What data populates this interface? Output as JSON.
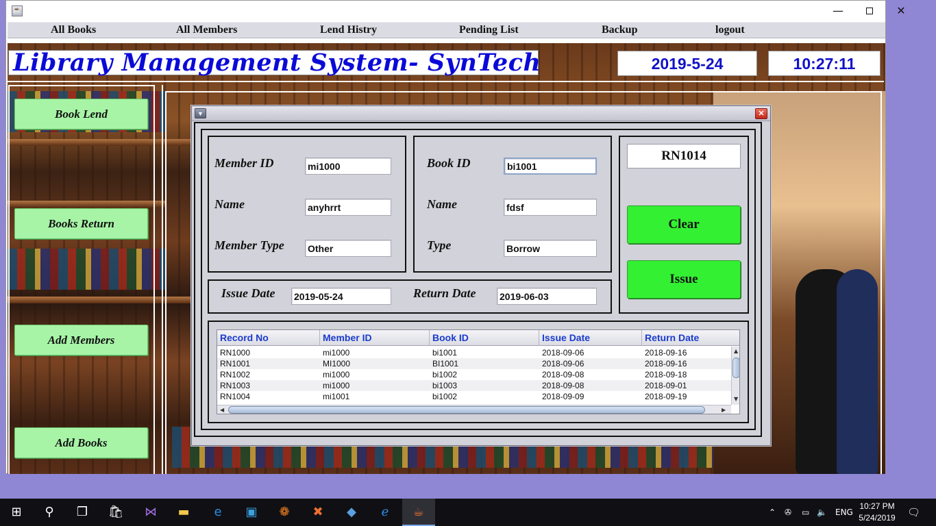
{
  "window": {
    "app_icon": "java-cup-icon",
    "minimize": "—",
    "close": "✕"
  },
  "menu": {
    "items": [
      "All Books",
      "All Members",
      "Lend Histry",
      "Pending List",
      "Backup",
      "logout"
    ]
  },
  "header": {
    "title": "Library Management System- SynTech",
    "date": "2019-5-24",
    "time": "10:27:11"
  },
  "sidebar": {
    "buttons": [
      "Book Lend",
      "Books Return",
      "Add Members",
      "Add Books"
    ]
  },
  "dialog": {
    "member": {
      "id_label": "Member ID",
      "id_value": "mi1000",
      "name_label": "Name",
      "name_value": "anyhrrt",
      "type_label": "Member Type",
      "type_value": "Other"
    },
    "book": {
      "id_label": "Book ID",
      "id_value": "bi1001",
      "name_label": "Name",
      "name_value": "fdsf",
      "type_label": "Type",
      "type_value": "Borrow"
    },
    "record_no": "RN1014",
    "clear_label": "Clear",
    "issue_label": "Issue",
    "issue_date_label": "Issue Date",
    "issue_date_value": "2019-05-24",
    "return_date_label": "Return Date",
    "return_date_value": "2019-06-03",
    "table": {
      "columns": [
        "Record No",
        "Member ID",
        "Book ID",
        "Issue Date",
        "Return Date"
      ],
      "rows": [
        [
          "RN1000",
          "mi1000",
          "bi1001",
          "2018-09-06",
          "2018-09-16"
        ],
        [
          "RN1001",
          "MI1000",
          "BI1001",
          "2018-09-06",
          "2018-09-16"
        ],
        [
          "RN1002",
          "mi1000",
          "bi1002",
          "2018-09-08",
          "2018-09-18"
        ],
        [
          "RN1003",
          "mi1000",
          "bi1003",
          "2018-09-08",
          "2018-09-01"
        ],
        [
          "RN1004",
          "mi1001",
          "bi1002",
          "2018-09-09",
          "2018-09-19"
        ]
      ]
    }
  },
  "taskbar": {
    "language": "ENG",
    "clock_time": "10:27 PM",
    "clock_date": "5/24/2019",
    "icons": [
      "windows-start-icon",
      "search-icon",
      "task-view-icon",
      "store-icon",
      "visual-studio-icon",
      "file-explorer-icon",
      "edge-icon",
      "app-icon",
      "uc-browser-icon",
      "xampp-icon",
      "virtualbox-icon",
      "internet-explorer-icon",
      "java-icon"
    ]
  }
}
